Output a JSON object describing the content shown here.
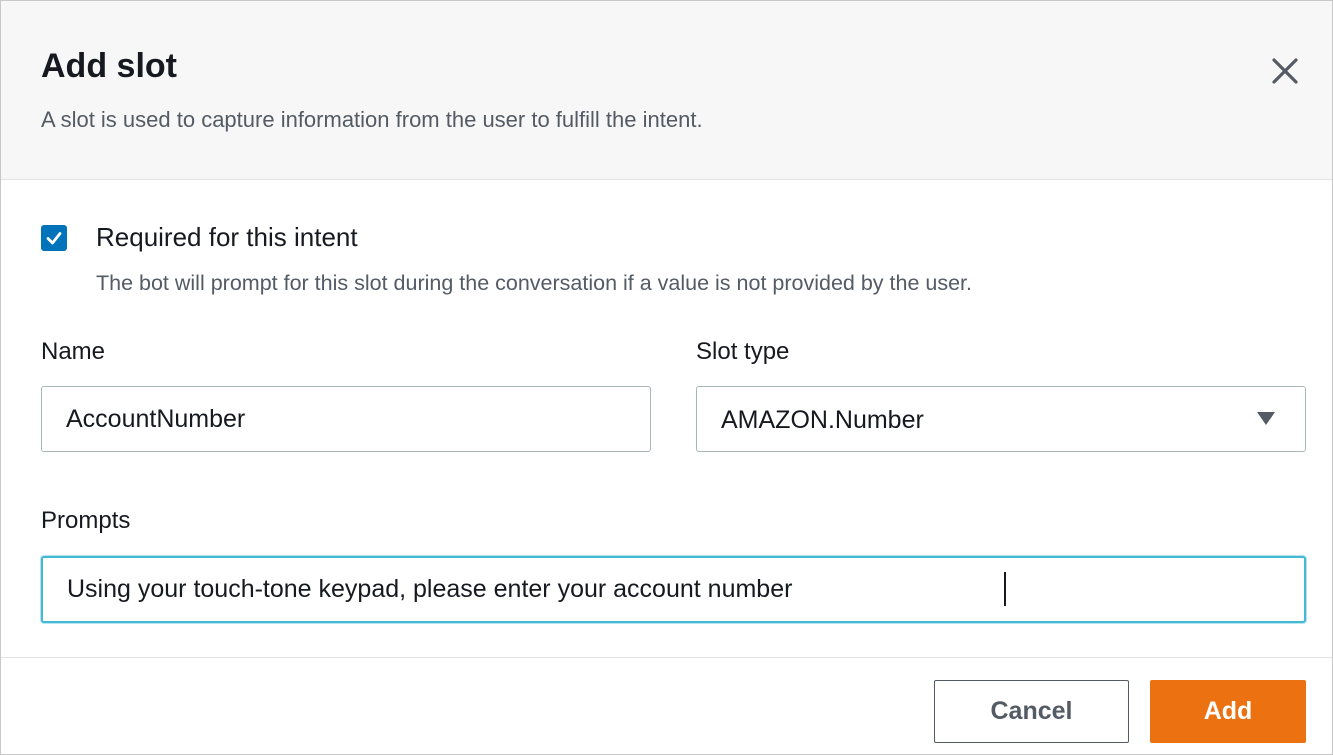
{
  "modal": {
    "title": "Add slot",
    "subtitle": "A slot is used to capture information from the user to fulfill the intent."
  },
  "required": {
    "checked": true,
    "label": "Required for this intent",
    "description": "The bot will prompt for this slot during the conversation if a value is not provided by the user."
  },
  "name_field": {
    "label": "Name",
    "value": "AccountNumber"
  },
  "slot_type": {
    "label": "Slot type",
    "selected": "AMAZON.Number"
  },
  "prompts": {
    "label": "Prompts",
    "value": "Using your touch-tone keypad, please enter your account number"
  },
  "footer": {
    "cancel_label": "Cancel",
    "add_label": "Add"
  },
  "icons": {
    "close": "close-icon",
    "check": "checkmark-icon",
    "dropdown": "caret-down-icon"
  },
  "colors": {
    "accent_blue": "#0073bb",
    "primary_orange": "#ec7211",
    "focus_ring": "#44b9d6",
    "header_bg": "#f7f7f7"
  }
}
